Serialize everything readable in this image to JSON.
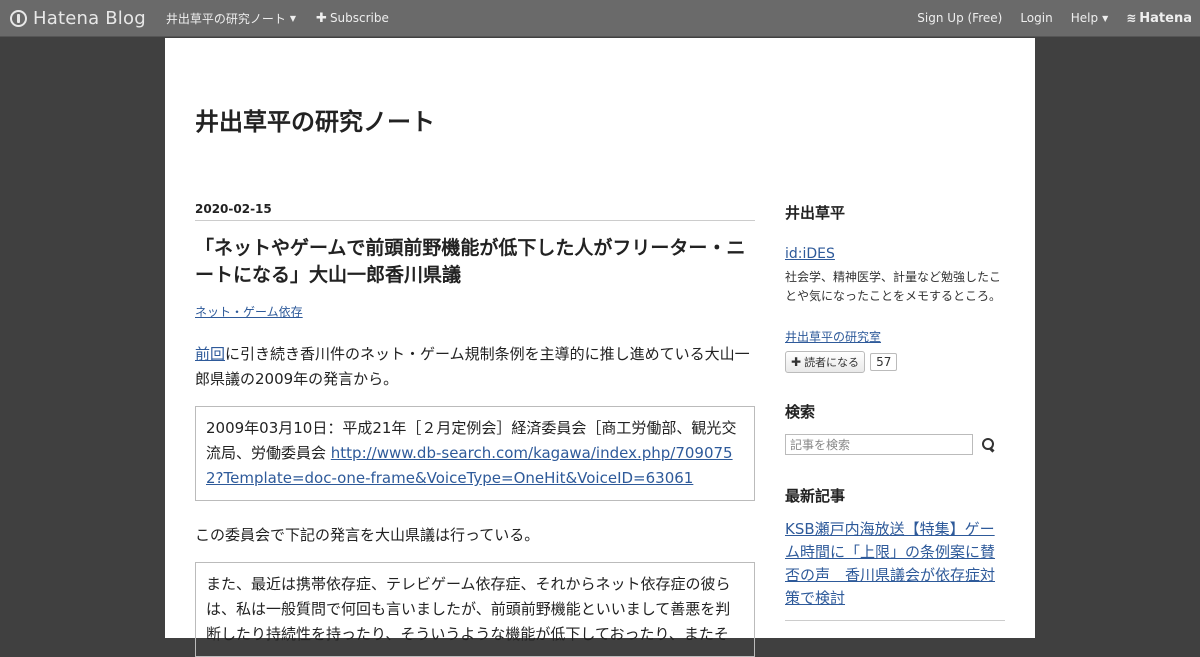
{
  "globalheader": {
    "logo_text": "Hatena Blog",
    "blog_menu_label": "井出草平の研究ノート",
    "subscribe_label": "Subscribe",
    "signup_label": "Sign Up (Free)",
    "login_label": "Login",
    "help_label": "Help",
    "hatena_label": "Hatena"
  },
  "blog": {
    "title": "井出草平の研究ノート"
  },
  "entry": {
    "date": "2020-02-15",
    "title": "「ネットやゲームで前頭前野機能が低下した人がフリーター・ニートになる」大山一郎香川県議",
    "category": "ネット・ゲーム依存",
    "intro_link": "前回",
    "intro_text": "に引き続き香川件のネット・ゲーム規制条例を主導的に推し進めている大山一郎県議の2009年の発言から。",
    "quote1_text": "2009年03月10日：平成21年［２月定例会］経済委員会［商工労働部、観光交流局、労働委員会 ",
    "quote1_link": "http://www.db-search.com/kagawa/index.php/7090752?Template=doc-one-frame&VoiceType=OneHit&VoiceID=63061",
    "para2": "この委員会で下記の発言を大山県議は行っている。",
    "quote2_text": "また、最近は携帯依存症、テレビゲーム依存症、それからネット依存症の彼らは、私は一般質問で何回も言いましたが、前頭前野機能といいまして善悪を判断したり持続性を持ったり、そういうような機能が低下しておったり、またそ"
  },
  "sidebar": {
    "profile_heading": "井出草平",
    "profile_id": "id:iDES",
    "profile_desc": "社会学、精神医学、計量など勉強したことや気になったことをメモするところ。",
    "lab_link": "井出草平の研究室",
    "reader_button": "読者になる",
    "reader_count": "57",
    "search_heading": "検索",
    "search_placeholder": "記事を検索",
    "recent_heading": "最新記事",
    "recent_items": [
      "KSB瀬戸内海放送【特集】ゲーム時間に「上限」の条例案に賛否の声　香川県議会が依存症対策で検討"
    ]
  }
}
